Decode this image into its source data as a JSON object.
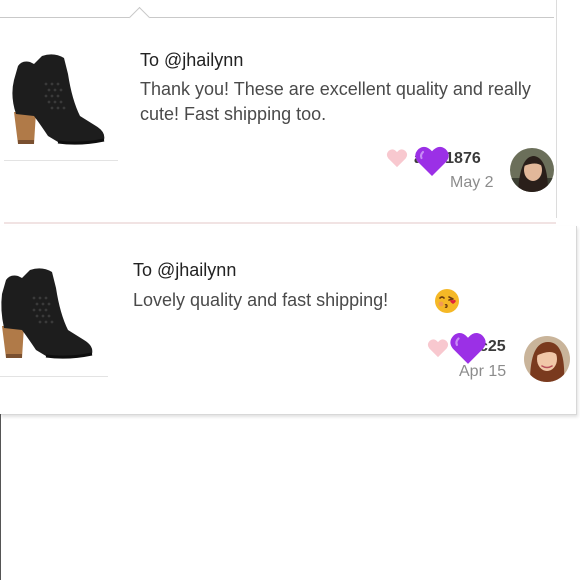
{
  "reviews": [
    {
      "to": "To @jhailynn",
      "message": "Thank you! These are excellent quality and really cute! Fast shipping too.",
      "username": "a      sa1876",
      "date": "May 2"
    },
    {
      "to": "To @jhailynn",
      "message": "Lovely quality and fast shipping!",
      "emoji": "kissing-face-with-heart",
      "username": "c25",
      "date": "Apr 15"
    }
  ],
  "colors": {
    "pink_heart": "#f8c8cf",
    "purple_heart": "#9b30e6",
    "card_border": "#d8d8d8"
  },
  "icons": [
    "heart-icon",
    "purple-heart-emoji",
    "kissing-face-emoji"
  ]
}
